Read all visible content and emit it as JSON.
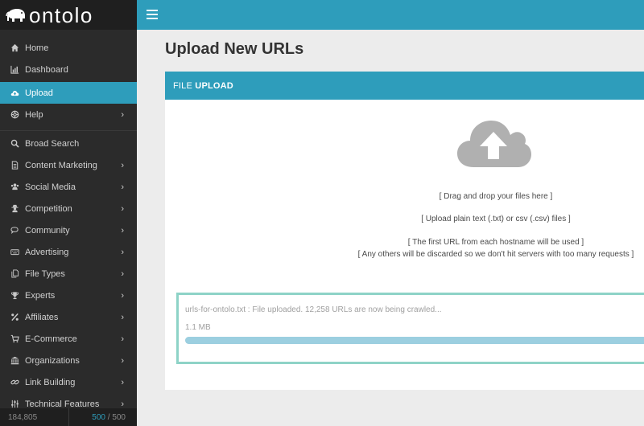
{
  "brand": {
    "name": "ontolo"
  },
  "sidebar": {
    "items": [
      {
        "label": "Home",
        "icon": "home-icon",
        "chevron": false,
        "active": false
      },
      {
        "label": "Dashboard",
        "icon": "bar-chart-icon",
        "chevron": false,
        "active": false
      },
      {
        "label": "Upload",
        "icon": "cloud-upload-icon",
        "chevron": false,
        "active": true
      },
      {
        "label": "Help",
        "icon": "lifebuoy-icon",
        "chevron": true,
        "active": false
      },
      {
        "label": "Broad Search",
        "icon": "search-icon",
        "chevron": false,
        "active": false
      },
      {
        "label": "Content Marketing",
        "icon": "document-icon",
        "chevron": true,
        "active": false
      },
      {
        "label": "Social Media",
        "icon": "users-icon",
        "chevron": true,
        "active": false
      },
      {
        "label": "Competition",
        "icon": "user-secret-icon",
        "chevron": true,
        "active": false
      },
      {
        "label": "Community",
        "icon": "comments-icon",
        "chevron": true,
        "active": false
      },
      {
        "label": "Advertising",
        "icon": "keyboard-icon",
        "chevron": true,
        "active": false
      },
      {
        "label": "File Types",
        "icon": "files-icon",
        "chevron": true,
        "active": false
      },
      {
        "label": "Experts",
        "icon": "trophy-icon",
        "chevron": true,
        "active": false
      },
      {
        "label": "Affiliates",
        "icon": "percent-icon",
        "chevron": true,
        "active": false
      },
      {
        "label": "E-Commerce",
        "icon": "cart-icon",
        "chevron": true,
        "active": false
      },
      {
        "label": "Organizations",
        "icon": "bank-icon",
        "chevron": true,
        "active": false
      },
      {
        "label": "Link Building",
        "icon": "link-icon",
        "chevron": true,
        "active": false
      },
      {
        "label": "Technical Features",
        "icon": "sliders-icon",
        "chevron": true,
        "active": false
      }
    ],
    "chevron_glyph": "›",
    "footer": {
      "count": "184,805",
      "used": "500",
      "divider": " / ",
      "total": "500"
    }
  },
  "page": {
    "title_light": "Upload ",
    "title_bold": "New URLs"
  },
  "panel": {
    "header_light": "FILE ",
    "header_bold": "UPLOAD",
    "lines": [
      "[ Drag and drop your files here ]",
      "[ Upload plain text (.txt) or csv (.csv) files ]",
      "[ The first URL from each hostname will be used ]",
      "[ Any others will be discarded so we don't hit servers with too many requests ]"
    ],
    "file": {
      "status": "urls-for-ontolo.txt : File uploaded. 12,258 URLs are now being crawled...",
      "size": "1.1 MB",
      "progress_percent": 100
    }
  },
  "colors": {
    "accent": "#2e9dbb",
    "sidebar_bg": "#2b2b2b",
    "upload_border": "#8ed3c7",
    "progress": "#9ccfe0"
  }
}
